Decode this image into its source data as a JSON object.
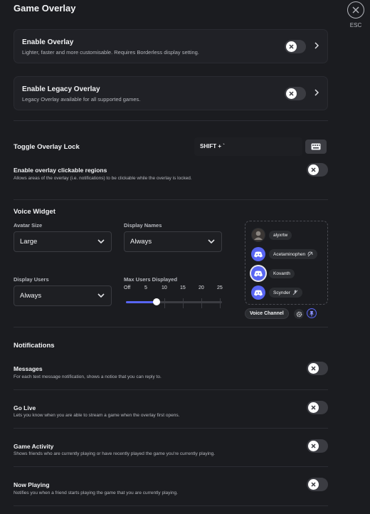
{
  "header": {
    "title": "Game Overlay",
    "close_label": "ESC"
  },
  "cards": [
    {
      "title": "Enable Overlay",
      "description": "Lighter, faster and more customisable. Requires Borderless display setting.",
      "enabled": false
    },
    {
      "title": "Enable Legacy Overlay",
      "description": "Legacy Overlay available for all supported games.",
      "enabled": false
    }
  ],
  "overlay_lock": {
    "label": "Toggle Overlay Lock",
    "keybind": "SHIFT + `"
  },
  "clickable_regions": {
    "title": "Enable overlay clickable regions",
    "description": "Allows areas of the overlay (i.e. notifications) to be clickable while the overlay is locked.",
    "enabled": false
  },
  "voice_widget": {
    "title": "Voice Widget",
    "avatar_size": {
      "label": "Avatar Size",
      "value": "Large"
    },
    "display_names": {
      "label": "Display Names",
      "value": "Always"
    },
    "display_users": {
      "label": "Display Users",
      "value": "Always"
    },
    "max_users": {
      "label": "Max Users Displayed",
      "ticks": [
        "Off",
        "5",
        "10",
        "15",
        "20",
        "25"
      ],
      "value_fraction": 0.32
    },
    "preview_users": [
      "alyxrtw",
      "Acetaminophen",
      "Kovanth",
      "Scynder"
    ],
    "channel_label": "Voice Channel"
  },
  "notifications": {
    "title": "Notifications",
    "items": [
      {
        "title": "Messages",
        "description": "For each text message notification, shows a notice that you can reply to.",
        "enabled": false
      },
      {
        "title": "Go Live",
        "description": "Lets you know when you are able to stream a game when the overlay first opens.",
        "enabled": false
      },
      {
        "title": "Game Activity",
        "description": "Shows friends who are currently playing or have recently played the game you're currently playing.",
        "enabled": false
      },
      {
        "title": "Now Playing",
        "description": "Notifies you when a friend starts playing the game that you are currently playing.",
        "enabled": false
      }
    ]
  },
  "colors": {
    "background": "#1b1c20",
    "accent": "#5865f2",
    "toggle_off": "#3b3c42"
  }
}
